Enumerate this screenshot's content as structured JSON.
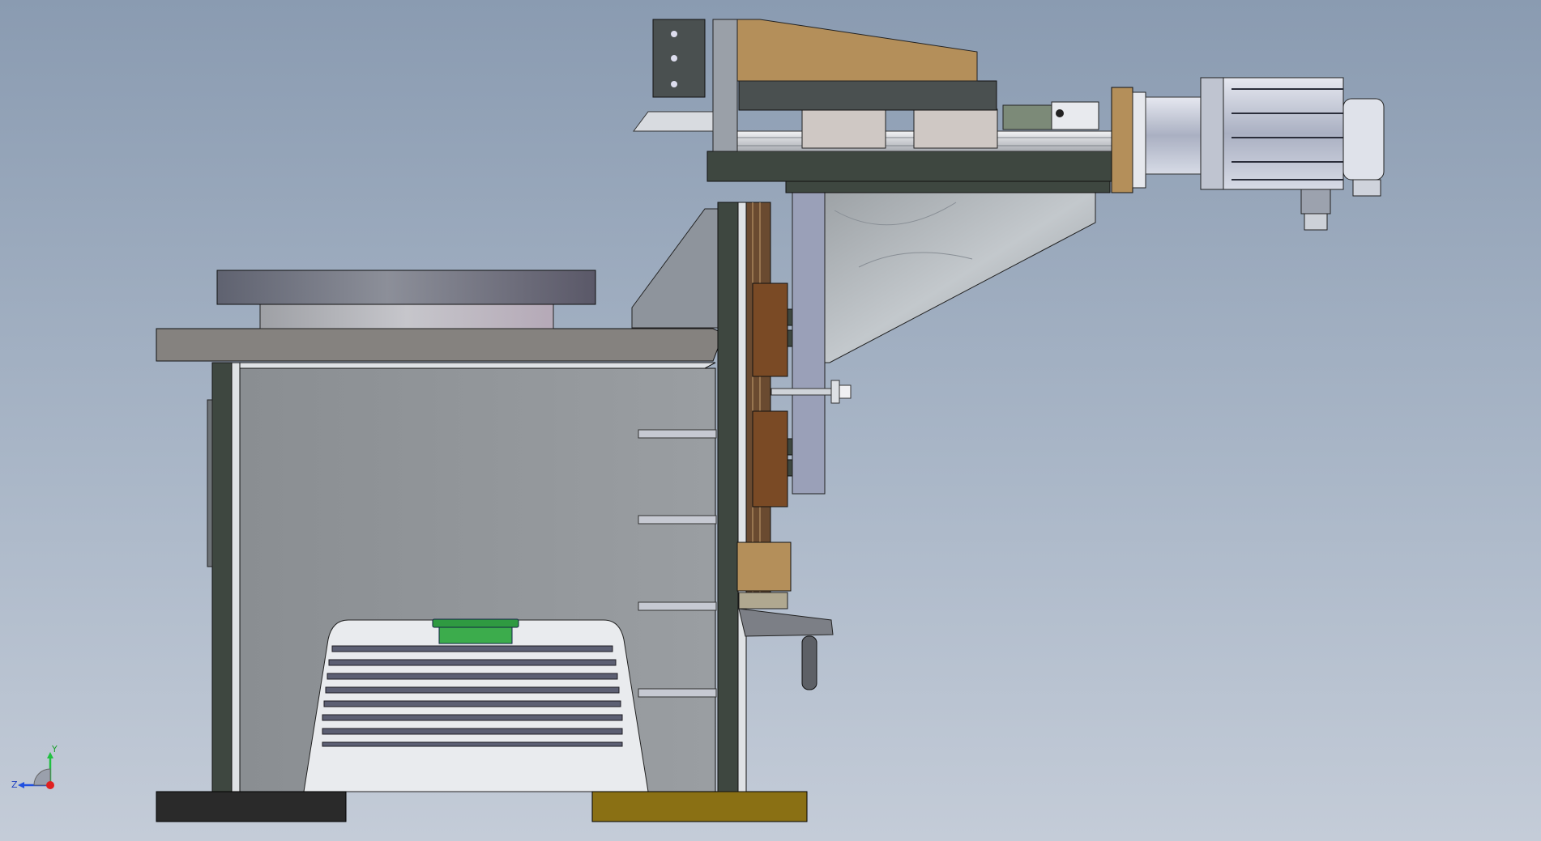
{
  "triad": {
    "x_label": "",
    "y_label": "Y",
    "z_label": "Z"
  },
  "colors": {
    "background_top": "#8a9bb1",
    "background_bottom": "#c4ccd8",
    "frame_panel": "#8f9396",
    "dark_plate": "#3e4740",
    "bronze": "#b48f5a",
    "brown_bearing": "#7a4a25",
    "green_part": "#3cac4c",
    "olive_foot": "#8a7014",
    "black_foot": "#2a2a2a",
    "motor": "#c4c8d4",
    "y_axis": "#20c040",
    "z_axis": "#2050e0",
    "x_axis": "#e02020"
  }
}
